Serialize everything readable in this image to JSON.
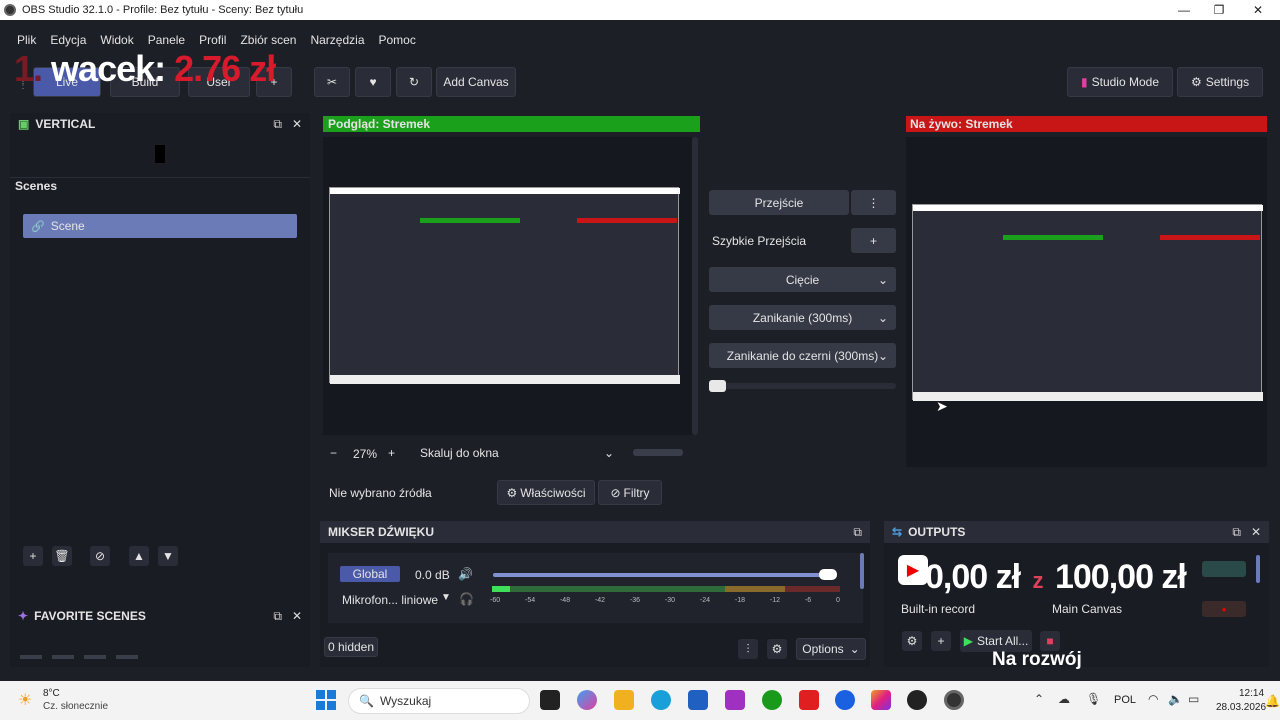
{
  "window": {
    "title": "OBS Studio 32.1.0 - Profile: Bez tytułu - Sceny: Bez tytułu"
  },
  "menu": [
    "Plik",
    "Edycja",
    "Widok",
    "Panele",
    "Profil",
    "Zbiór scen",
    "Narzędzia",
    "Pomoc"
  ],
  "overlay": {
    "rank": "1.",
    "name": "wacek:",
    "amount": "2.76 zł"
  },
  "toolbar": {
    "tabs": [
      "Live",
      "Build",
      "User",
      "+"
    ],
    "add_canvas": "Add Canvas",
    "studio_mode": "Studio Mode",
    "settings": "Settings"
  },
  "vertical_dock": {
    "title": "VERTICAL"
  },
  "scenes": {
    "title": "Scenes",
    "items": [
      "Scene"
    ]
  },
  "favorite_scenes": {
    "title": "FAVORITE SCENES"
  },
  "preview": {
    "label": "Podgląd: Stremek",
    "zoom": "27%",
    "scale_mode": "Skaluj do okna"
  },
  "live": {
    "label": "Na żywo: Stremek"
  },
  "transitions": {
    "button": "Przejście",
    "quick": "Szybkie Przejścia",
    "items": [
      "Cięcie",
      "Zanikanie (300ms)",
      "Zanikanie do czerni (300ms)"
    ]
  },
  "source_bar": {
    "no_source": "Nie wybrano źródła",
    "properties": "Właściwości",
    "filters": "Filtry"
  },
  "mixer": {
    "title": "MIKSER DŹWIĘKU",
    "global_label": "Global",
    "global_db": "0.0 dB",
    "mic_label": "Mikrofon... liniowe",
    "ticks": [
      "-60",
      "-54",
      "-48",
      "-42",
      "-36",
      "-30",
      "-24",
      "-18",
      "-12",
      "-6",
      "0"
    ],
    "hidden": "0 hidden",
    "options": "Options"
  },
  "outputs": {
    "title": "OUTPUTS",
    "record_label": "Built-in record",
    "canvas_label": "Main Canvas",
    "start_all": "Start All..."
  },
  "goal_overlay": {
    "current": "0,00 zł",
    "sep": "z",
    "target": "100,00 zł",
    "caption": "Na rozwój"
  },
  "taskbar": {
    "weather_temp": "8°C",
    "weather_desc": "Cz. słonecznie",
    "search": "Wyszukaj",
    "lang": "POL",
    "time": "12:14",
    "date": "28.03.2026"
  },
  "colors": {
    "preview_green": "#1aa01a",
    "live_red": "#c81515",
    "scene_selected": "#6b7bb8",
    "accent_blue": "#4a5aa8"
  }
}
